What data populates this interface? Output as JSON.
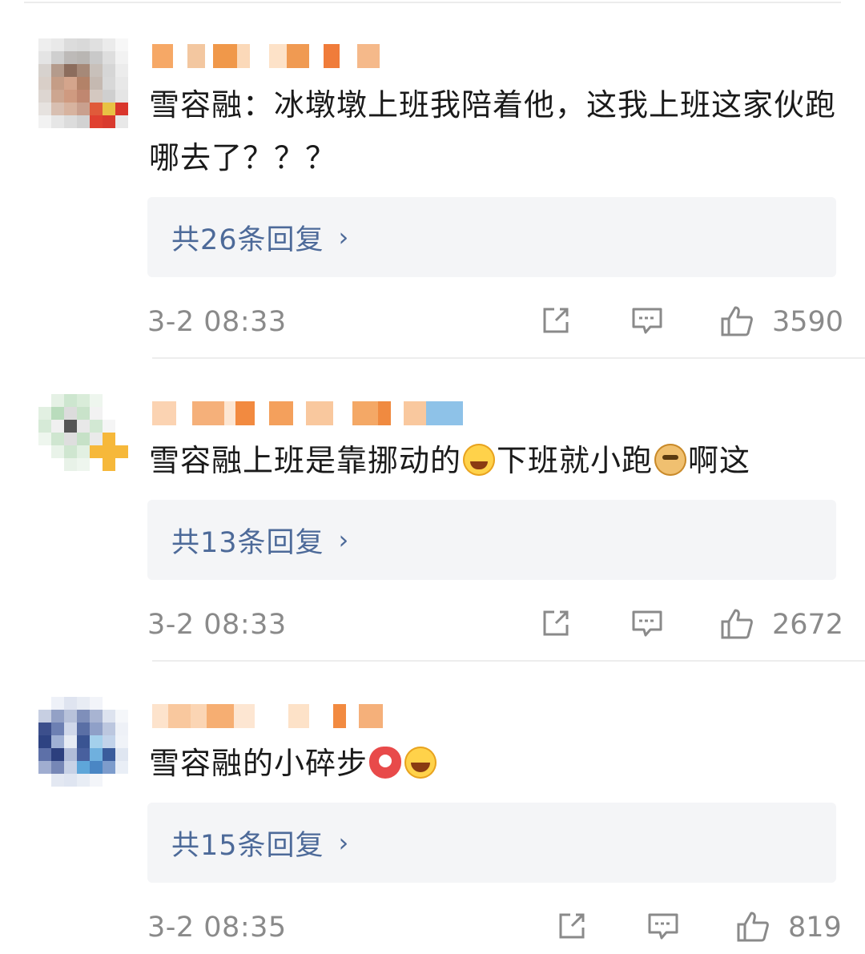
{
  "comments": [
    {
      "text": "雪容融：冰墩墩上班我陪着他，这我上班这家伙跑哪去了？？？",
      "replies": "共26条回复",
      "time": "3-2 08:33",
      "likes": "3590",
      "emojis": []
    },
    {
      "text_parts": [
        "雪容融上班是靠挪动的",
        "下班就小跑",
        "啊这"
      ],
      "replies": "共13条回复",
      "time": "3-2 08:33",
      "likes": "2672",
      "emojis": [
        "laugh-cry-icon",
        "doge-icon"
      ]
    },
    {
      "text": "雪容融的小碎步",
      "replies": "共15条回复",
      "time": "3-2 08:35",
      "likes": "819",
      "emojis": [
        "fortune-icon",
        "laugh-icon"
      ]
    }
  ],
  "colors": {
    "text": "#1a1a1a",
    "reply_link": "#4d6a99",
    "meta_gray": "#8a8a8a",
    "reply_bg": "#f4f5f7",
    "blur_orange": "#f5a25a"
  }
}
